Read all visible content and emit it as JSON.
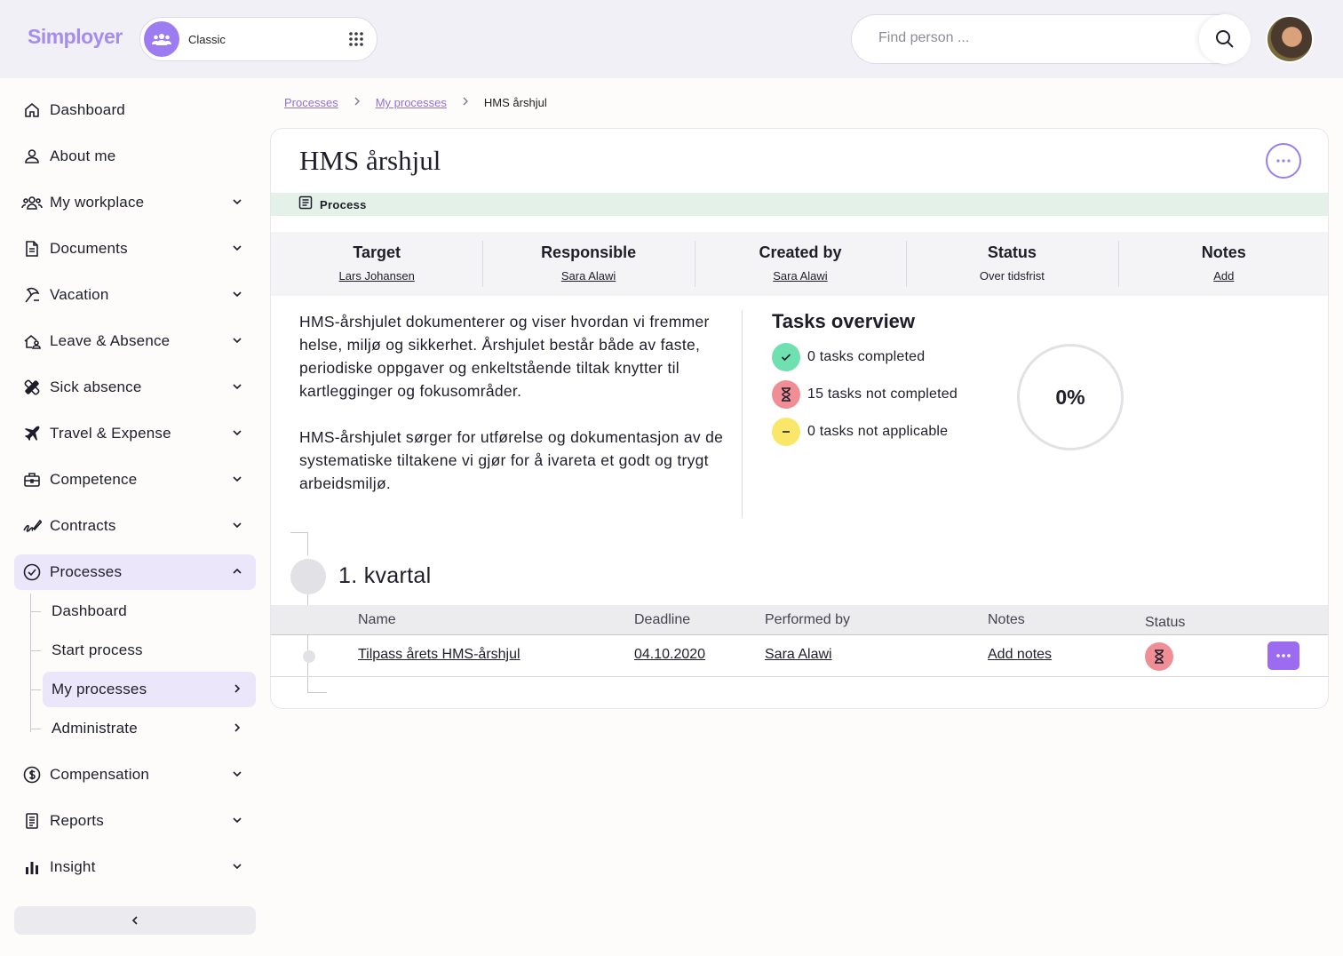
{
  "brand": {
    "name": "Simployer"
  },
  "workspace": {
    "label": "Classic"
  },
  "search": {
    "placeholder": "Find person ..."
  },
  "sidebar": {
    "items": [
      {
        "label": "Dashboard",
        "icon": "home-icon"
      },
      {
        "label": "About me",
        "icon": "person-icon"
      },
      {
        "label": "My workplace",
        "icon": "group-icon"
      },
      {
        "label": "Documents",
        "icon": "document-icon"
      },
      {
        "label": "Vacation",
        "icon": "beach-icon"
      },
      {
        "label": "Leave & Absence",
        "icon": "leave-icon"
      },
      {
        "label": "Sick absence",
        "icon": "bandage-icon"
      },
      {
        "label": "Travel & Expense",
        "icon": "plane-icon"
      },
      {
        "label": "Competence",
        "icon": "briefcase-icon"
      },
      {
        "label": "Contracts",
        "icon": "signature-icon"
      },
      {
        "label": "Processes",
        "icon": "check-circle-icon"
      },
      {
        "label": "Compensation",
        "icon": "dollar-icon"
      },
      {
        "label": "Reports",
        "icon": "report-icon"
      },
      {
        "label": "Insight",
        "icon": "bar-chart-icon"
      }
    ],
    "processes_sub": [
      "Dashboard",
      "Start process",
      "My processes",
      "Administrate"
    ]
  },
  "breadcrumb": {
    "items": [
      "Processes",
      "My processes"
    ],
    "current": "HMS årshjul"
  },
  "page": {
    "title": "HMS årshjul",
    "type_label": "Process",
    "info": [
      {
        "heading": "Target",
        "value": "Lars Johansen"
      },
      {
        "heading": "Responsible",
        "value": "Sara Alawi"
      },
      {
        "heading": "Created by",
        "value": "Sara Alawi"
      },
      {
        "heading": "Status",
        "value": "Over tidsfrist"
      },
      {
        "heading": "Notes",
        "value": "Add"
      }
    ],
    "description": [
      "HMS-årshjulet dokumenterer og viser hvordan vi fremmer helse, miljø og sikkerhet. Årshjulet består både av faste, periodiske oppgaver og enkeltstående tiltak knytter til kartlegginger og fokusområder.",
      "HMS-årshjulet sørger for utførelse og dokumentasjon av de systematiske tiltakene vi gjør for å ivareta et godt og trygt arbeidsmiljø."
    ]
  },
  "overview": {
    "title": "Tasks overview",
    "completed": "0 tasks completed",
    "not_completed": "15 tasks not completed",
    "not_applicable": "0 tasks not applicable",
    "progress_label": "0%",
    "progress_value": 0,
    "colors": {
      "completed": "#6fe0b0",
      "not_completed": "#f08e96",
      "not_applicable": "#fae76a"
    }
  },
  "quarter": {
    "title": "1. kvartal",
    "columns": [
      "Name",
      "Deadline",
      "Performed by",
      "Notes",
      "Status"
    ],
    "rows": [
      {
        "name": "Tilpass årets HMS-årshjul",
        "deadline": "04.10.2020",
        "performed_by": "Sara Alawi",
        "notes": "Add notes",
        "status_icon": "hourglass-icon"
      }
    ]
  },
  "colors": {
    "accent": "#9c7cf0",
    "active_bg": "#ece6fb",
    "type_bar": "#e3f1e8"
  }
}
